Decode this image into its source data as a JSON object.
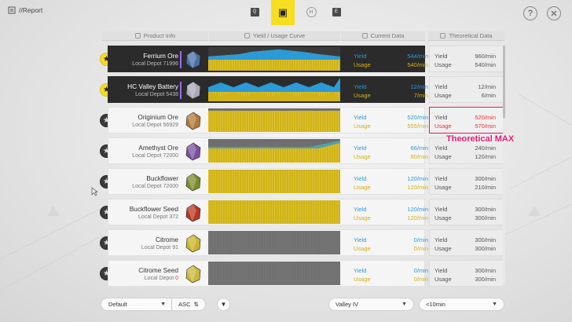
{
  "title": "//Report",
  "tabs": [
    {
      "label": "Q",
      "name": "tab-q"
    },
    {
      "label": "▣",
      "name": "tab-report"
    },
    {
      "label": "H",
      "name": "tab-h"
    },
    {
      "label": "E",
      "name": "tab-e"
    }
  ],
  "top_icons": {
    "help": "?",
    "close": "✕"
  },
  "headers": {
    "product_info": "Product Info",
    "curve": "Yield / Usage Curve",
    "current": "Current Data",
    "theoretical": "Theoretical Data"
  },
  "labels": {
    "yield": "Yield",
    "usage": "Usage"
  },
  "rows": [
    {
      "name": "Ferrium Ore",
      "depot_label": "Local Depot",
      "depot_count": "71996",
      "favorite": true,
      "cur_yield": "544/min",
      "cur_usage": "540/min",
      "theo_yield": "960/min",
      "theo_usage": "540/min",
      "icon": "ferrium-ore-icon",
      "color": "#4a6fa6"
    },
    {
      "name": "HC Valley Battery",
      "depot_label": "Local Depot",
      "depot_count": "5438",
      "favorite": true,
      "cur_yield": "12/min",
      "cur_usage": "7/min",
      "theo_yield": "12/min",
      "theo_usage": "6/min",
      "icon": "battery-icon",
      "color": "#a8a8b5"
    },
    {
      "name": "Originium Ore",
      "depot_label": "Local Depot",
      "depot_count": "56929",
      "favorite": false,
      "cur_yield": "520/min",
      "cur_usage": "555/min",
      "theo_yield": "520/min",
      "theo_usage": "570/min",
      "icon": "originium-ore-icon",
      "color": "#b07a3a",
      "highlight": true
    },
    {
      "name": "Amethyst Ore",
      "depot_label": "Local Depot",
      "depot_count": "72000",
      "favorite": false,
      "cur_yield": "66/min",
      "cur_usage": "80/min",
      "theo_yield": "240/min",
      "theo_usage": "120/min",
      "icon": "amethyst-ore-icon",
      "color": "#7a4fa0"
    },
    {
      "name": "Buckflower",
      "depot_label": "Local Depot",
      "depot_count": "72000",
      "favorite": false,
      "cur_yield": "120/min",
      "cur_usage": "120/min",
      "theo_yield": "300/min",
      "theo_usage": "210/min",
      "icon": "buckflower-icon",
      "color": "#7c8c2c"
    },
    {
      "name": "Buckflower Seed",
      "depot_label": "Local Depot",
      "depot_count": "372",
      "favorite": false,
      "cur_yield": "120/min",
      "cur_usage": "120/min",
      "theo_yield": "300/min",
      "theo_usage": "300/min",
      "icon": "buckflower-seed-icon",
      "color": "#b83520"
    },
    {
      "name": "Citrome",
      "depot_label": "Local Depot",
      "depot_count": "91",
      "favorite": false,
      "cur_yield": "0/min",
      "cur_usage": "0/min",
      "theo_yield": "300/min",
      "theo_usage": "300/min",
      "icon": "citrome-icon",
      "color": "#c9b42a"
    },
    {
      "name": "Citrome Seed",
      "depot_label": "Local Depot",
      "depot_count": "0",
      "depot_red": true,
      "favorite": false,
      "cur_yield": "0/min",
      "cur_usage": "0/min",
      "theo_yield": "300/min",
      "theo_usage": "300/min",
      "icon": "citrome-seed-icon",
      "color": "#c8b83a"
    }
  ],
  "annotation": "Theoretical MAX",
  "bottom": {
    "sort_value": "Default",
    "asc_label": "ASC",
    "region": "Valley IV",
    "time_range": "<10min"
  },
  "colors": {
    "yield": "#2a9bd8",
    "usage": "#d0b316",
    "favorite": "#f5dc25",
    "highlight": "#e8146e",
    "tab_active": "#f7de1f"
  }
}
